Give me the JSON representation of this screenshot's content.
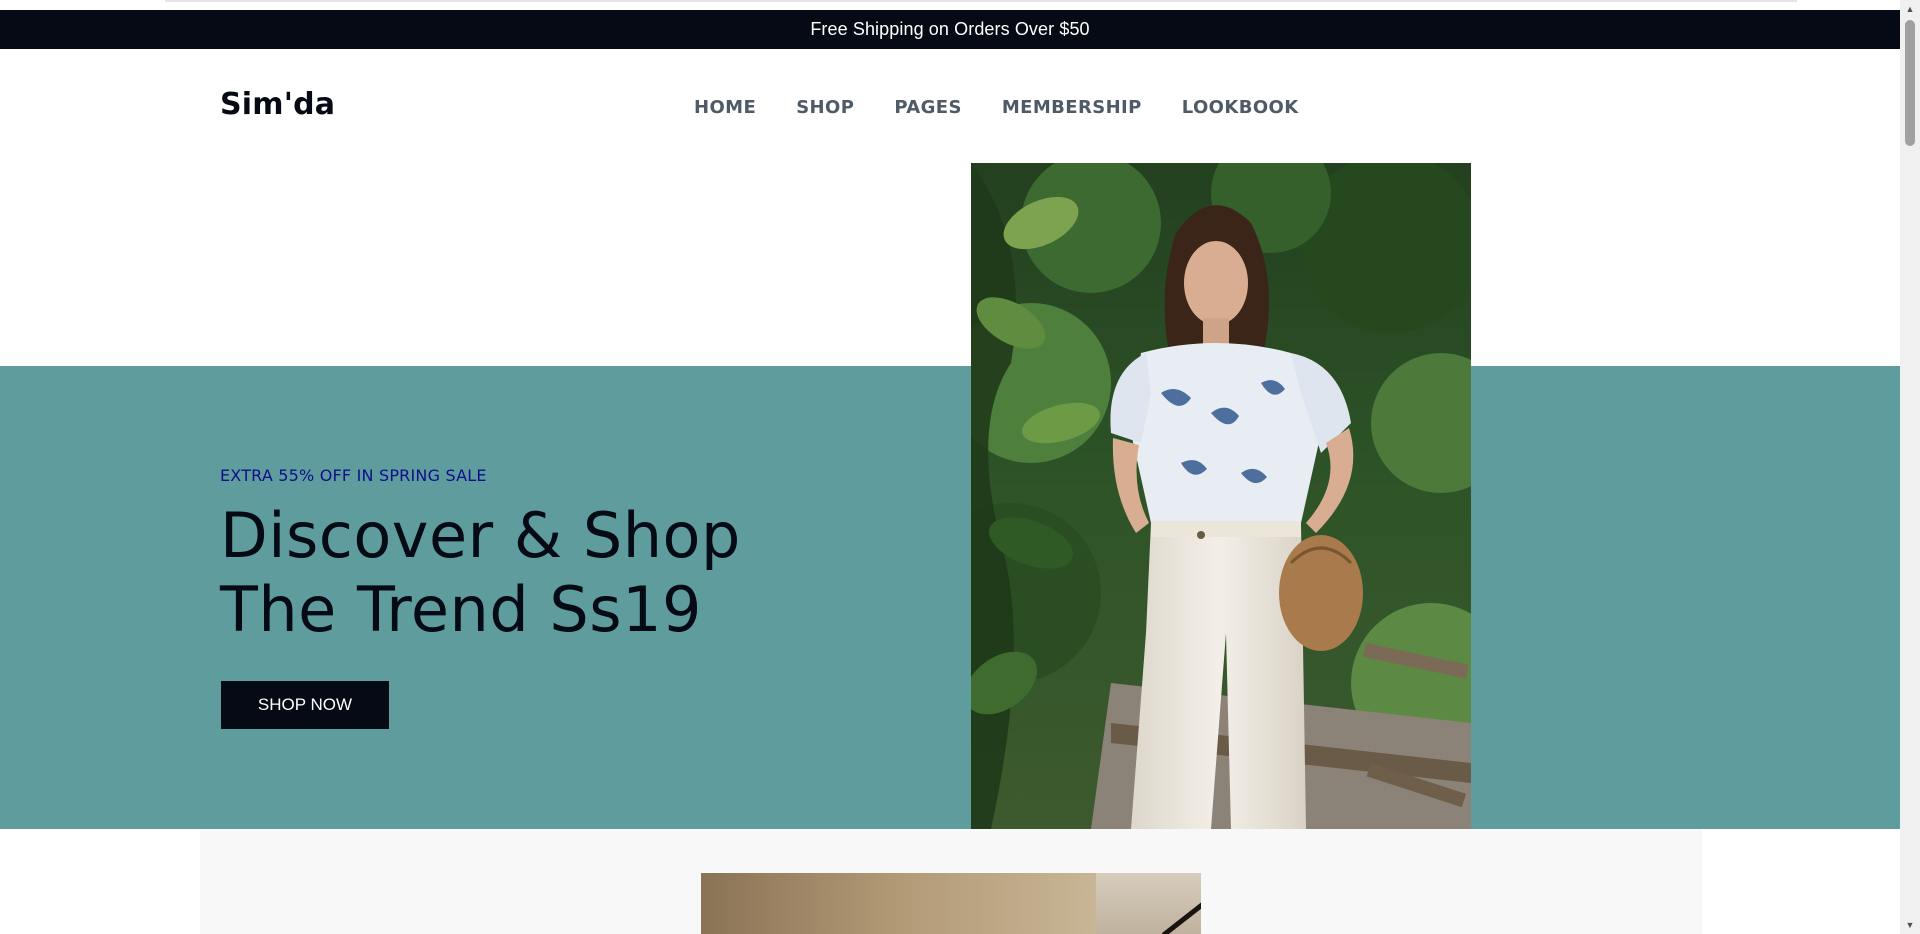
{
  "announcement": {
    "text": "Free Shipping on Orders Over $50"
  },
  "header": {
    "logo": "Sim'da",
    "nav": [
      "HOME",
      "SHOP",
      "PAGES",
      "MEMBERSHIP",
      "LOOKBOOK"
    ]
  },
  "hero": {
    "eyebrow": "EXTRA 55% OFF IN SPRING SALE",
    "headline_line1": "Discover & Shop",
    "headline_line2": "The Trend Ss19",
    "cta_label": "SHOP NOW"
  },
  "colors": {
    "announcement_bg": "#050a14",
    "hero_band": "#5f9c9e",
    "eyebrow": "#0d0f8a",
    "button_bg": "#050a14"
  },
  "scrollbar": {
    "up_icon": "triangle-up-icon",
    "down_icon": "triangle-down-icon"
  }
}
